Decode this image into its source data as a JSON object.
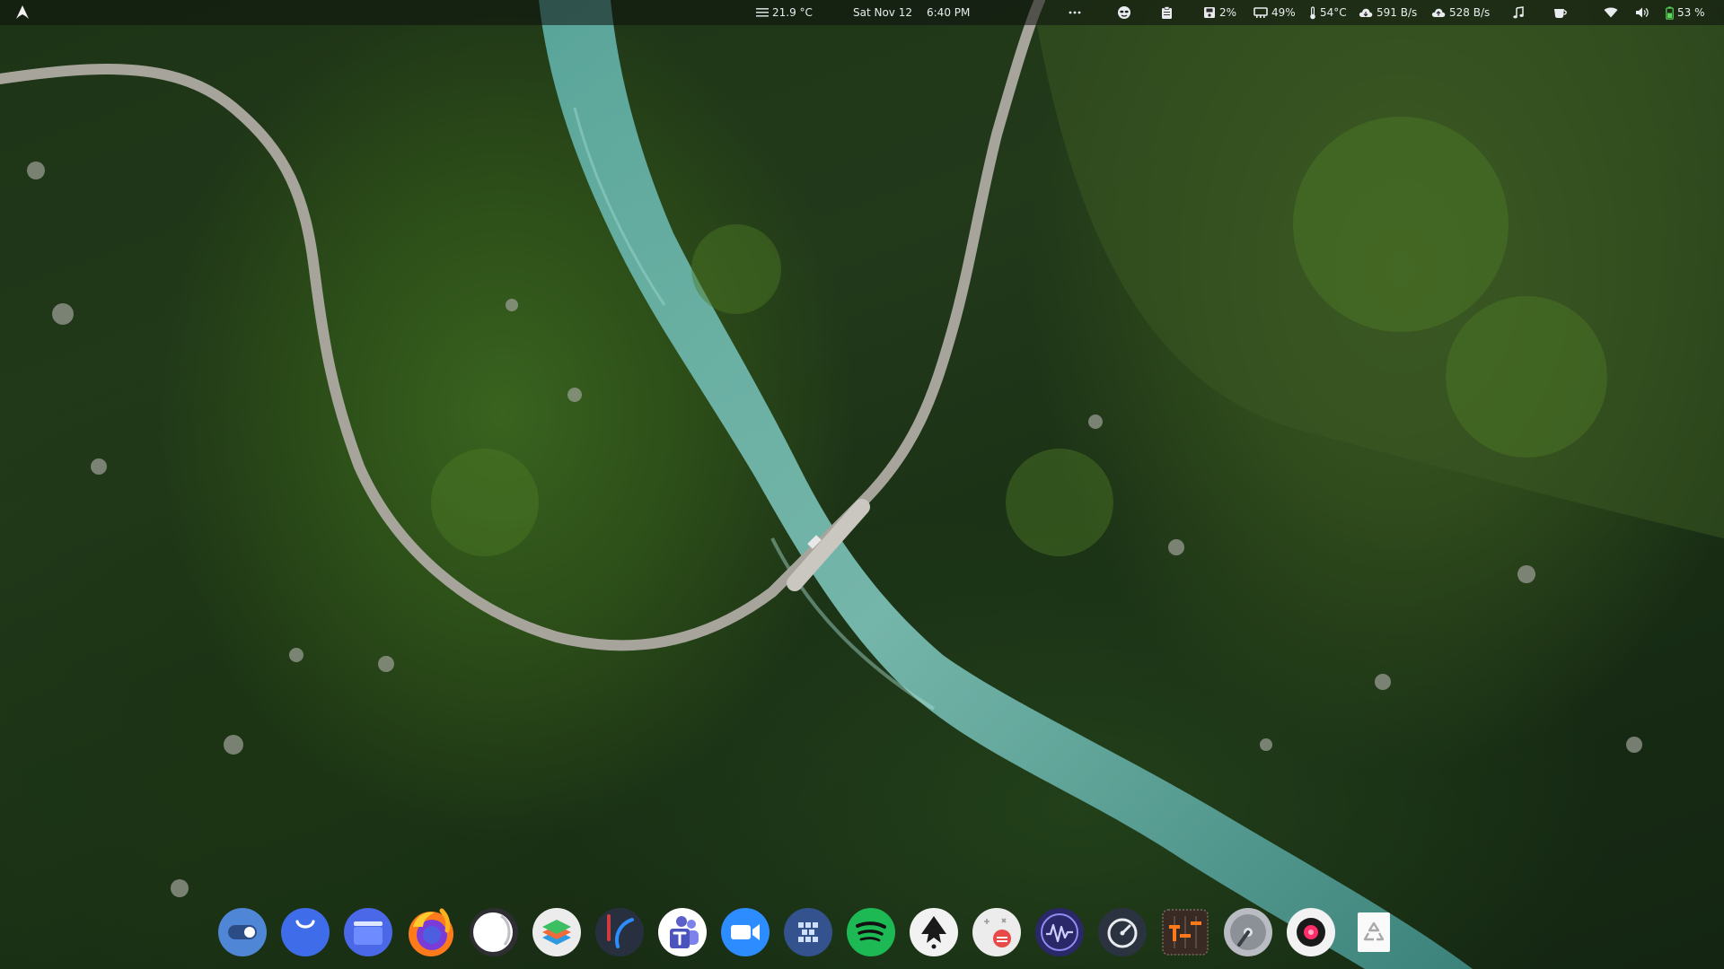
{
  "topbar": {
    "launcher_icon": "arch-logo-icon",
    "weather": {
      "icon": "fog-icon",
      "text": "21.9 °C"
    },
    "clock": {
      "date": "Sat Nov 12",
      "time": "6:40 PM"
    },
    "overflow_icon": "ellipsis-icon",
    "tray": [
      {
        "name": "mask-icon",
        "text": ""
      },
      {
        "name": "clipboard-icon",
        "text": ""
      }
    ],
    "stats": {
      "disk": {
        "icon": "disk-icon",
        "text": "2%"
      },
      "memory": {
        "icon": "memory-icon",
        "text": "49%"
      },
      "temperature": {
        "icon": "thermometer-icon",
        "text": "54°C"
      },
      "download": {
        "icon": "cloud-down-icon",
        "text": "591 B/s"
      },
      "upload": {
        "icon": "cloud-up-icon",
        "text": "528 B/s"
      }
    },
    "music_icon": "music-note-icon",
    "coffee_icon": "coffee-cup-icon",
    "wifi_icon": "wifi-icon",
    "volume_icon": "volume-icon",
    "battery": {
      "icon": "battery-icon",
      "text": "53 %"
    }
  },
  "dock": {
    "apps": [
      {
        "name": "toggle-app-icon",
        "color": "#5a8fd8"
      },
      {
        "name": "blue-smile-app-icon",
        "color": "#3f6ce8"
      },
      {
        "name": "files-app-icon",
        "color": "#5472ea"
      },
      {
        "name": "firefox-icon",
        "color": "#ff7a1a"
      },
      {
        "name": "white-circle-app-icon",
        "color": "#ffffff"
      },
      {
        "name": "layers-app-icon",
        "color": "#e8e8e8"
      },
      {
        "name": "dark-swoosh-app-icon",
        "color": "#2a3240"
      },
      {
        "name": "teams-icon",
        "color": "#5b5fc7"
      },
      {
        "name": "zoom-icon",
        "color": "#2d8cff"
      },
      {
        "name": "qr-grid-app-icon",
        "color": "#3a5c9e"
      },
      {
        "name": "spotify-icon",
        "color": "#1db954"
      },
      {
        "name": "inkscape-icon",
        "color": "#f0f0f0"
      },
      {
        "name": "badge-notes-app-icon",
        "color": "#ececec"
      },
      {
        "name": "waveform-app-icon",
        "color": "#2c2a6e"
      },
      {
        "name": "speedometer-app-icon",
        "color": "#2c3340"
      },
      {
        "name": "mixer-app-icon",
        "color": "#3a2a24"
      },
      {
        "name": "disk-utility-icon",
        "color": "#b9bcc2"
      },
      {
        "name": "record-app-icon",
        "color": "#f2f2f2"
      },
      {
        "name": "trash-icon",
        "color": "#ffffff"
      }
    ]
  }
}
